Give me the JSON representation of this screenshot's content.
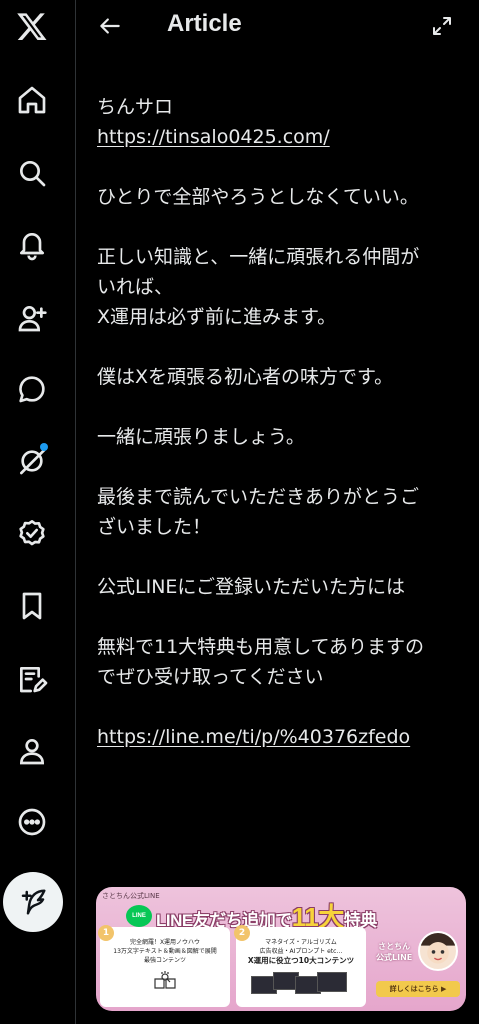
{
  "header": {
    "title": "Article"
  },
  "article": {
    "lines": [
      "ちんサロ",
      "https://tinsalo0425.com/",
      "",
      "ひとりで全部やろうとしなくていい。",
      "",
      "正しい知識と、一緒に頑張れる仲間が",
      "いれば、",
      " X運用は必ず前に進みます。",
      "",
      "僕はXを頑張る初心者の味方です。",
      "",
      "一緒に頑張りましょう。",
      "",
      "最後まで読んでいただきありがとうご",
      "ざいました！",
      "",
      "公式LINEにご登録いただいた方には",
      "",
      "無料で11大特典も用意してありますの",
      "でぜひ受け取ってください",
      "",
      "https://line.me/ti/p/%40376zfedo"
    ]
  },
  "banner": {
    "small_label": "さとちん公式LINE",
    "logo_text": "LINE",
    "title_part1": "LINE友だち追加で",
    "title_big": "11大",
    "title_part2": "特典",
    "card1": {
      "num": "1",
      "line1": "完全網羅！X運用ノウハウ",
      "line2": "13万文字テキスト＆動画＆図解で展開",
      "line3": "最強コンテンツ"
    },
    "card2": {
      "num": "2",
      "line1": "マネタイズ・アルゴリズム",
      "line2": "広告収益・AIプロンプト etc…",
      "line3": "X運用に役立つ10大コンテンツ"
    },
    "side_name_1": "さとちん",
    "side_name_2": "公式LINE",
    "detail_button": "詳しくはこちら ▶"
  },
  "colors": {
    "background": "#000000",
    "text": "#e7e9ea",
    "accent_dot": "#1d9bf0",
    "line_green": "#06c755"
  },
  "icons": {
    "sidebar": [
      "x-logo-icon",
      "home-icon",
      "search-icon",
      "bell-icon",
      "add-person-icon",
      "chat-bubble-icon",
      "grok-icon",
      "verified-icon",
      "bookmark-icon",
      "article-edit-icon",
      "profile-icon",
      "more-icon",
      "compose-icon"
    ]
  }
}
